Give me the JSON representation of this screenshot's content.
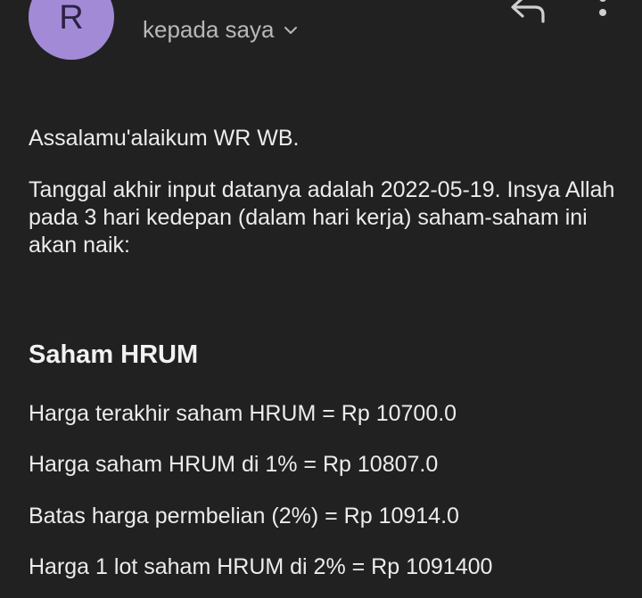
{
  "header": {
    "avatar_letter": "R",
    "recipient_label": "kepada saya",
    "icons": {
      "expand": "chevron-down-icon",
      "reply": "reply-icon",
      "more": "more-vertical-icon"
    },
    "colors": {
      "avatar_bg": "#a38ad6",
      "background": "#212121"
    }
  },
  "message": {
    "greeting": "Assalamu'alaikum WR WB.",
    "intro": "Tanggal akhir input datanya adalah 2022-05-19. Insya Allah pada 3 hari kedepan (dalam hari kerja) saham-saham ini akan naik:",
    "stock_heading": "Saham HRUM",
    "lines": [
      "Harga terakhir saham HRUM = Rp 10700.0",
      "Harga saham HRUM di 1% = Rp 10807.0",
      "Batas harga permbelian (2%) = Rp 10914.0",
      "Harga 1 lot saham HRUM di 2% = Rp 1091400"
    ]
  }
}
